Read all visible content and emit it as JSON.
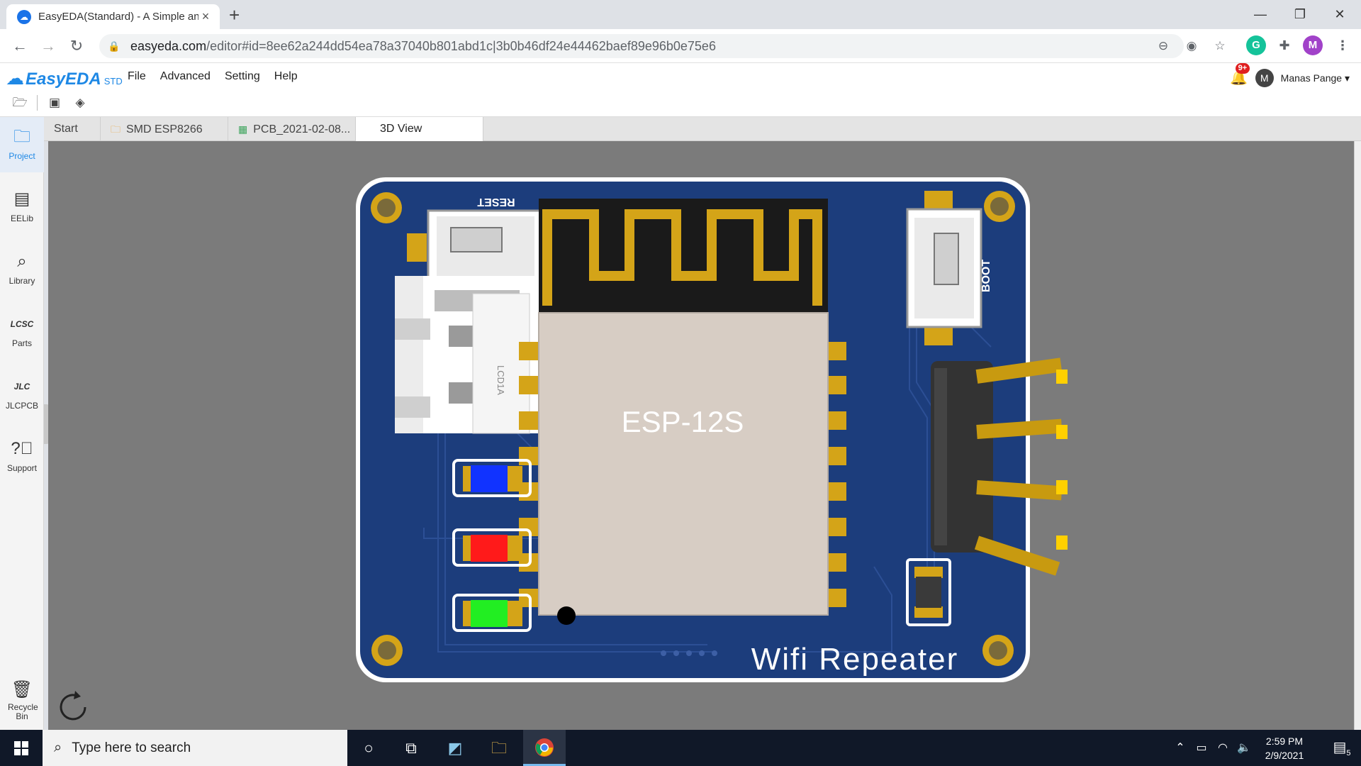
{
  "browser": {
    "tab_title": "EasyEDA(Standard) - A Simple an",
    "url_domain": "easyeda.com",
    "url_path": "/editor#id=8ee62a244dd54ea78a37040b801abd1c|3b0b46df24e44462baef89e96b0e75e6",
    "profile_initial": "M",
    "ext_initial": "G"
  },
  "app": {
    "logo_text": "EasyEDA",
    "logo_suffix": "STD",
    "menu": [
      "File",
      "Advanced",
      "Setting",
      "Help"
    ],
    "notification_badge": "9+",
    "user_initial": "M",
    "user_name": "Manas Pange"
  },
  "leftnav": {
    "items": [
      {
        "label": "Project",
        "icon": "folder-icon"
      },
      {
        "label": "EELib",
        "icon": "chip-icon"
      },
      {
        "label": "Library",
        "icon": "magnifier-icon"
      },
      {
        "label": "Parts",
        "icon": "lcsc-icon"
      },
      {
        "label": "JLCPCB",
        "icon": "jlc-icon"
      },
      {
        "label": "Support",
        "icon": "question-icon"
      }
    ],
    "recycle_label": "Recycle Bin"
  },
  "doctabs": [
    {
      "label": "Start"
    },
    {
      "label": "SMD ESP8266"
    },
    {
      "label": "PCB_2021-02-08..."
    },
    {
      "label": "3D View"
    }
  ],
  "pcb": {
    "module_label": "ESP-12S",
    "board_label": "Wifi Repeater",
    "reset_label": "RESET",
    "boot_label": "BOOT",
    "connector_label": "LCD1A",
    "colors": {
      "board": "#1c3d7c",
      "gold": "#d4a418",
      "module_shield": "#d7cdc4",
      "antenna_bg": "#1a1a1a",
      "led_blue": "#1133ff",
      "led_red": "#ff1a1a",
      "led_green": "#22ee22"
    }
  },
  "taskbar": {
    "search_placeholder": "Type here to search",
    "time": "2:59 PM",
    "date": "2/9/2021",
    "notification_count": "5"
  }
}
